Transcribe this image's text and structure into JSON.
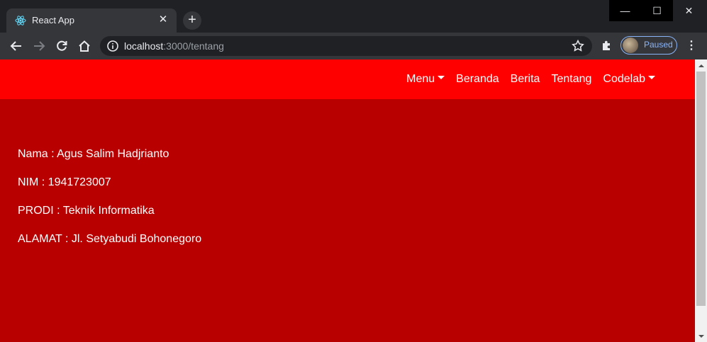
{
  "browser": {
    "tab": {
      "title": "React App",
      "icon": "react-icon",
      "close_glyph": "✕"
    },
    "new_tab_glyph": "+",
    "window_controls": {
      "minimize": "—",
      "maximize": "☐",
      "close": "✕"
    },
    "address": {
      "host": "localhost",
      "path": ":3000/tentang"
    },
    "profile": {
      "label": "Paused",
      "accent": "#8ab4f8"
    },
    "menu_glyph": "⋮"
  },
  "navbar": {
    "background": "#ff0000",
    "items": [
      {
        "label": "Menu",
        "dropdown": true
      },
      {
        "label": "Beranda",
        "dropdown": false
      },
      {
        "label": "Berita",
        "dropdown": false
      },
      {
        "label": "Tentang",
        "dropdown": false
      },
      {
        "label": "Codelab",
        "dropdown": true
      }
    ]
  },
  "content": {
    "background": "#b90000",
    "lines": [
      "Nama : Agus Salim Hadjrianto",
      "NIM : 1941723007",
      "PRODI : Teknik Informatika",
      "ALAMAT : Jl. Setyabudi Bohonegoro"
    ]
  }
}
